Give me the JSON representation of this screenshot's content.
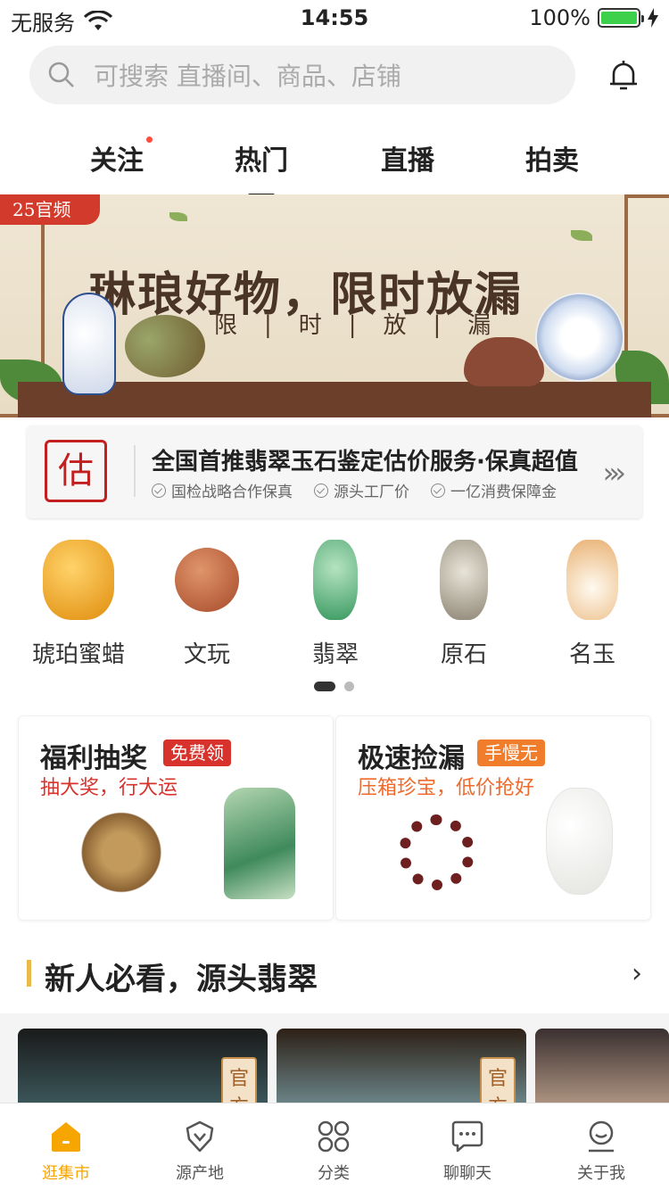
{
  "status_bar": {
    "carrier": "无服务",
    "time": "14:55",
    "battery": "100%"
  },
  "search": {
    "placeholder": "可搜索 直播间、商品、店铺"
  },
  "tabs": [
    {
      "label": "关注",
      "dot": true
    },
    {
      "label": "热门",
      "active": true
    },
    {
      "label": "直播"
    },
    {
      "label": "拍卖"
    }
  ],
  "banner": {
    "badge": "25官频",
    "title": "琳琅好物，限时放漏",
    "subtitle": "限|时|放|漏"
  },
  "service": {
    "logo_char": "估",
    "headline": "全国首推翡翠玉石鉴定估价服务·保真超值",
    "features": [
      "国检战略合作保真",
      "源头工厂价",
      "一亿消费保障金"
    ]
  },
  "categories": [
    "琥珀蜜蜡",
    "文玩",
    "翡翠",
    "原石",
    "名玉"
  ],
  "category_pager": {
    "pages": 2,
    "current": 1
  },
  "promos": [
    {
      "title": "福利抽奖",
      "tag": "免费领",
      "subtitle": "抽大奖，行大运",
      "tag_color": "#d8322c",
      "subtitle_color": "#d8322c"
    },
    {
      "title": "极速捡漏",
      "tag": "手慢无",
      "subtitle": "压箱珍宝，低价抢好",
      "tag_color": "#ef7d2c",
      "subtitle_color": "#ef6a2c"
    }
  ],
  "section": {
    "title": "新人必看，源头翡翠"
  },
  "live_cards": [
    {
      "official": "官方"
    },
    {
      "official": "官方"
    },
    {}
  ],
  "tabbar": [
    {
      "label": "逛集市",
      "icon": "home-icon",
      "active": true
    },
    {
      "label": "源产地",
      "icon": "gem-icon"
    },
    {
      "label": "分类",
      "icon": "grid-icon"
    },
    {
      "label": "聊聊天",
      "icon": "chat-icon"
    },
    {
      "label": "关于我",
      "icon": "profile-icon"
    }
  ],
  "colors": {
    "accent": "#f7a500",
    "brand_red": "#c41f1f",
    "section_bar": "#e9b94a"
  }
}
